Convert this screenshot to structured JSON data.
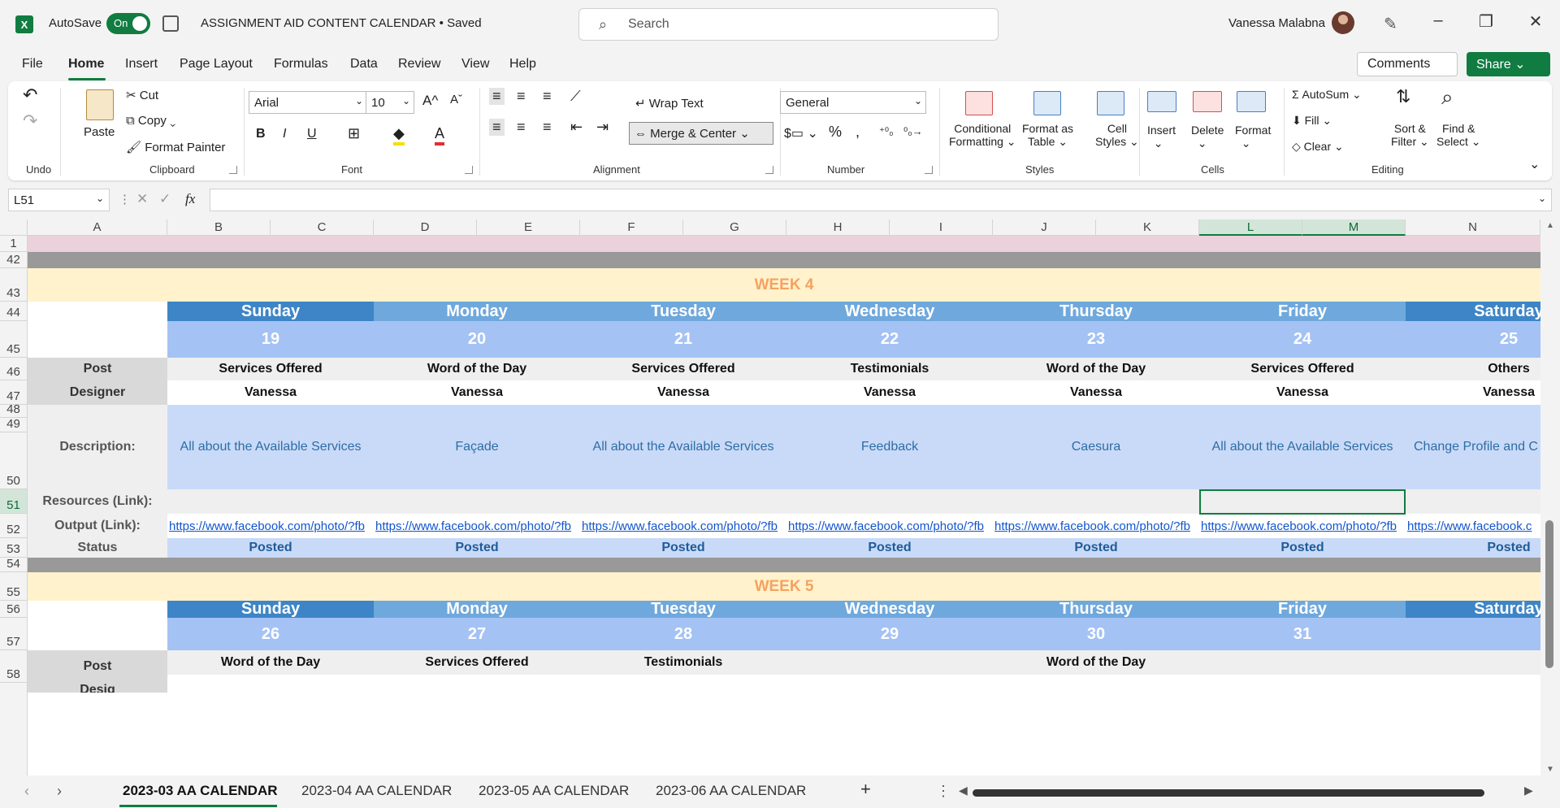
{
  "app": {
    "logo": "X",
    "autosave_label": "AutoSave",
    "autosave_state": "On",
    "doc_title": "ASSIGNMENT AID CONTENT CALENDAR • Saved",
    "search_placeholder": "Search",
    "user_name": "Vanessa Malabna"
  },
  "menu": {
    "tabs": [
      "File",
      "Home",
      "Insert",
      "Page Layout",
      "Formulas",
      "Data",
      "Review",
      "View",
      "Help"
    ],
    "comments": "Comments",
    "share": "Share"
  },
  "ribbon": {
    "undo": "Undo",
    "clipboard": {
      "paste": "Paste",
      "cut": "Cut",
      "copy": "Copy",
      "format_painter": "Format Painter",
      "label": "Clipboard"
    },
    "font": {
      "name": "Arial",
      "size": "10",
      "bold": "B",
      "italic": "I",
      "underline": "U",
      "label": "Font"
    },
    "alignment": {
      "wrap": "Wrap Text",
      "merge": "Merge & Center",
      "label": "Alignment"
    },
    "number": {
      "format": "General",
      "label": "Number"
    },
    "styles": {
      "conditional": [
        "Conditional",
        "Formatting"
      ],
      "format_table": [
        "Format as",
        "Table"
      ],
      "cell_styles": [
        "Cell",
        "Styles"
      ],
      "label": "Styles"
    },
    "cells": {
      "insert": "Insert",
      "delete": "Delete",
      "format": "Format",
      "label": "Cells"
    },
    "editing": {
      "autosum": "AutoSum",
      "fill": "Fill",
      "clear": "Clear",
      "sort": [
        "Sort &",
        "Filter"
      ],
      "find": [
        "Find &",
        "Select"
      ],
      "label": "Editing"
    }
  },
  "formula_bar": {
    "namebox": "L51",
    "fx": "fx",
    "value": ""
  },
  "columns": [
    "A",
    "B",
    "C",
    "D",
    "E",
    "F",
    "G",
    "H",
    "I",
    "J",
    "K",
    "L",
    "M",
    "N"
  ],
  "rows": {
    "r1": "1",
    "r42": "42",
    "r43": "43",
    "r44": "44",
    "r45": "45",
    "r46": "46",
    "r47": "47",
    "r48": "48",
    "r49": "49",
    "r50": "50",
    "r51": "51",
    "r52": "52",
    "r53": "53",
    "r54": "54",
    "r55": "55",
    "r56": "56",
    "r57": "57",
    "r58": "58"
  },
  "week4": {
    "label": "WEEK 4",
    "days": [
      "Sunday",
      "Monday",
      "Tuesday",
      "Wednesday",
      "Thursday",
      "Friday",
      "Saturday"
    ],
    "dates": [
      "19",
      "20",
      "21",
      "22",
      "23",
      "24",
      "25"
    ],
    "post_label": "Post",
    "posts": [
      "Services Offered",
      "Word of the Day",
      "Services Offered",
      "Testimonials",
      "Word of the Day",
      "Services Offered",
      "Others"
    ],
    "designer_label": "Designer",
    "designers": [
      "Vanessa",
      "Vanessa",
      "Vanessa",
      "Vanessa",
      "Vanessa",
      "Vanessa",
      "Vanessa"
    ],
    "description_label": "Description:",
    "descriptions": [
      "All about the Available Services",
      "Façade",
      "All about the Available Services",
      "Feedback",
      "Caesura",
      "All about the Available Services",
      "Change Profile and C"
    ],
    "resources_label": "Resources (Link):",
    "output_label": "Output (Link):",
    "outputs": [
      "https://www.facebook.com/photo/?fb",
      "https://www.facebook.com/photo/?fb",
      "https://www.facebook.com/photo/?fb",
      "https://www.facebook.com/photo/?fb",
      "https://www.facebook.com/photo/?fb",
      "https://www.facebook.com/photo/?fb",
      "https://www.facebook.c"
    ],
    "status_label": "Status",
    "statuses": [
      "Posted",
      "Posted",
      "Posted",
      "Posted",
      "Posted",
      "Posted",
      "Posted"
    ]
  },
  "week5": {
    "label": "WEEK 5",
    "days": [
      "Sunday",
      "Monday",
      "Tuesday",
      "Wednesday",
      "Thursday",
      "Friday",
      "Saturday"
    ],
    "dates": [
      "26",
      "27",
      "28",
      "29",
      "30",
      "31",
      ""
    ],
    "post_label": "Post",
    "posts": [
      "Word of the Day",
      "Services Offered",
      "Testimonials",
      "",
      "Word of the Day",
      "",
      ""
    ],
    "designer_partial": "Desig"
  },
  "sheets": {
    "tabs": [
      "2023-03 AA CALENDAR",
      "2023-04 AA CALENDAR",
      "2023-05 AA CALENDAR",
      "2023-06 AA CALENDAR"
    ],
    "add": "+"
  }
}
